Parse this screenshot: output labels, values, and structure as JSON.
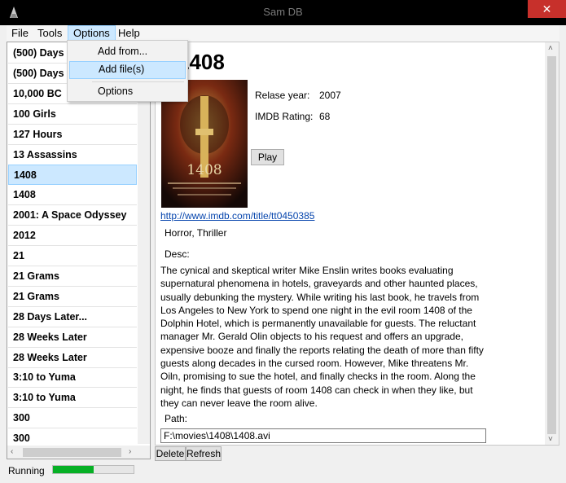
{
  "window": {
    "title": "Sam DB",
    "close_glyph": "✕"
  },
  "menu": {
    "file": "File",
    "tools": "Tools",
    "options": "Options",
    "help": "Help"
  },
  "options_menu": {
    "items": [
      "Add from...",
      "Add file(s)",
      "Options"
    ]
  },
  "movie_list": {
    "items": [
      "(500) Days of Summer",
      "(500) Days of Summer",
      "10,000 BC",
      "100 Girls",
      "127 Hours",
      "13 Assassins",
      "1408",
      "1408",
      "2001: A Space Odyssey",
      "2012",
      "21",
      "21 Grams",
      "21 Grams",
      "28 Days Later...",
      "28 Weeks Later",
      "28 Weeks Later",
      "3:10 to Yuma",
      "3:10 to Yuma",
      "300",
      "300"
    ],
    "selected_index": 6
  },
  "detail": {
    "title": "1408",
    "release_label": "Relase year:",
    "release_value": "2007",
    "rating_label": "IMDB Rating:",
    "rating_value": "68",
    "play_label": "Play",
    "link": "http://www.imdb.com/title/tt0450385",
    "genres": "Horror, Thriller",
    "desc_label": "Desc:",
    "description": "The cynical and skeptical writer Mike Enslin writes books evaluating supernatural phenomena in hotels, graveyards and other haunted places, usually debunking the mystery. While writing his last book, he travels from Los Angeles to New York to spend one night in the evil room 1408 of the Dolphin Hotel, which is permanently unavailable for guests. The reluctant manager Mr. Gerald Olin objects to his request and offers an upgrade, expensive booze and finally the reports relating the death of more than fifty guests along decades in the cursed room. However, Mike threatens Mr. Oiln, promising to sue the hotel, and finally checks in the room. Along the night, he finds that guests of room 1408 can check in when they like, but they can never leave the room alive.",
    "path_label": "Path:",
    "path_value": "F:\\movies\\1408\\1408.avi",
    "poster_text": "1408"
  },
  "buttons": {
    "delete": "Delete",
    "refresh": "Refresh"
  },
  "status": {
    "text": "Running",
    "progress": 0.5
  },
  "colors": {
    "accent": "#cce8ff",
    "progress": "#06b025",
    "close": "#c7302b",
    "link": "#0645ad"
  }
}
